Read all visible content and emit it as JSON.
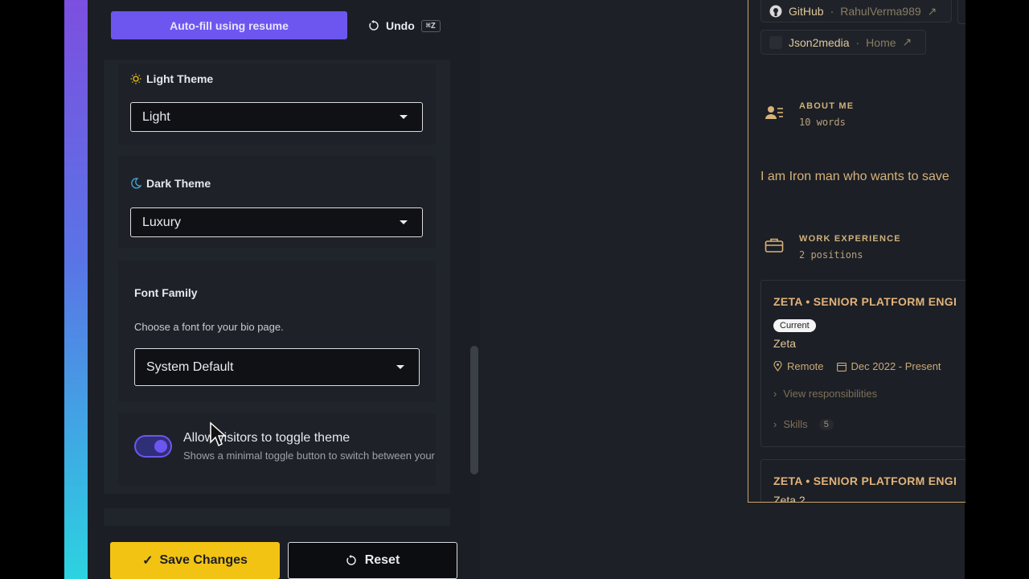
{
  "editor": {
    "autofill_label": "Auto-fill using resume",
    "undo_label": "Undo",
    "undo_shortcut": "⌘Z",
    "light_theme": {
      "label": "Light Theme",
      "value": "Light"
    },
    "dark_theme": {
      "label": "Dark Theme",
      "value": "Luxury"
    },
    "font_family": {
      "label": "Font Family",
      "help": "Choose a font for your bio page.",
      "value": "System Default"
    },
    "toggle_theme": {
      "label": "Allow visitors to toggle theme",
      "help": "Shows a minimal toggle button to switch between your",
      "enabled": true
    },
    "save_label": "Save Changes",
    "reset_label": "Reset"
  },
  "preview": {
    "links": [
      {
        "name": "GitHub",
        "sub": "RahulVerma989"
      },
      {
        "name": "Json2media",
        "sub": "Home"
      }
    ],
    "about": {
      "title": "ABOUT ME",
      "sub": "10 words",
      "text": "I am Iron man who wants to save"
    },
    "work": {
      "title": "WORK EXPERIENCE",
      "sub": "2 positions",
      "jobs": [
        {
          "title": "ZETA • SENIOR PLATFORM ENGI",
          "badge": "Current",
          "company": "Zeta",
          "location": "Remote",
          "dates": "Dec 2022 - Present",
          "responsibilities": "View responsibilities",
          "skills_label": "Skills",
          "skills_count": "5"
        },
        {
          "title": "ZETA • SENIOR PLATFORM ENGI",
          "company": "Zeta 2"
        }
      ]
    }
  },
  "colors": {
    "accent": "#6d56f0",
    "save": "#f2c313",
    "preview_gold": "#d7b27a"
  }
}
